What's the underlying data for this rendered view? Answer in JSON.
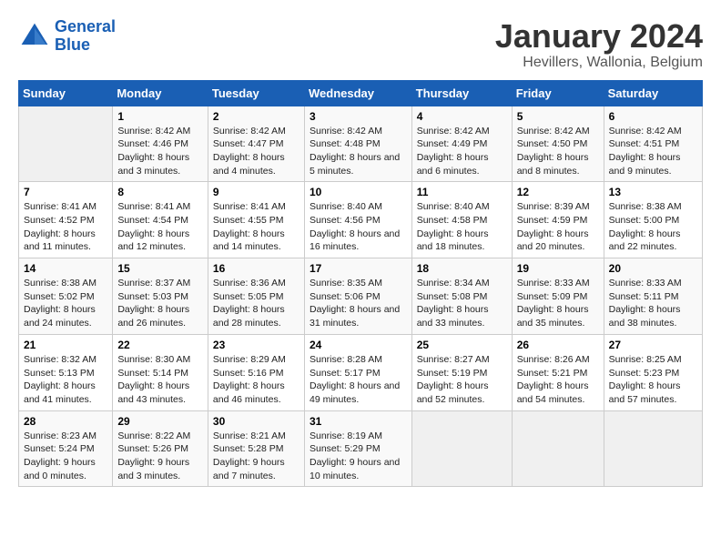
{
  "header": {
    "logo_line1": "General",
    "logo_line2": "Blue",
    "month_title": "January 2024",
    "subtitle": "Hevillers, Wallonia, Belgium"
  },
  "weekdays": [
    "Sunday",
    "Monday",
    "Tuesday",
    "Wednesday",
    "Thursday",
    "Friday",
    "Saturday"
  ],
  "weeks": [
    [
      {
        "day": "",
        "sunrise": "",
        "sunset": "",
        "daylight": ""
      },
      {
        "day": "1",
        "sunrise": "Sunrise: 8:42 AM",
        "sunset": "Sunset: 4:46 PM",
        "daylight": "Daylight: 8 hours and 3 minutes."
      },
      {
        "day": "2",
        "sunrise": "Sunrise: 8:42 AM",
        "sunset": "Sunset: 4:47 PM",
        "daylight": "Daylight: 8 hours and 4 minutes."
      },
      {
        "day": "3",
        "sunrise": "Sunrise: 8:42 AM",
        "sunset": "Sunset: 4:48 PM",
        "daylight": "Daylight: 8 hours and 5 minutes."
      },
      {
        "day": "4",
        "sunrise": "Sunrise: 8:42 AM",
        "sunset": "Sunset: 4:49 PM",
        "daylight": "Daylight: 8 hours and 6 minutes."
      },
      {
        "day": "5",
        "sunrise": "Sunrise: 8:42 AM",
        "sunset": "Sunset: 4:50 PM",
        "daylight": "Daylight: 8 hours and 8 minutes."
      },
      {
        "day": "6",
        "sunrise": "Sunrise: 8:42 AM",
        "sunset": "Sunset: 4:51 PM",
        "daylight": "Daylight: 8 hours and 9 minutes."
      }
    ],
    [
      {
        "day": "7",
        "sunrise": "Sunrise: 8:41 AM",
        "sunset": "Sunset: 4:52 PM",
        "daylight": "Daylight: 8 hours and 11 minutes."
      },
      {
        "day": "8",
        "sunrise": "Sunrise: 8:41 AM",
        "sunset": "Sunset: 4:54 PM",
        "daylight": "Daylight: 8 hours and 12 minutes."
      },
      {
        "day": "9",
        "sunrise": "Sunrise: 8:41 AM",
        "sunset": "Sunset: 4:55 PM",
        "daylight": "Daylight: 8 hours and 14 minutes."
      },
      {
        "day": "10",
        "sunrise": "Sunrise: 8:40 AM",
        "sunset": "Sunset: 4:56 PM",
        "daylight": "Daylight: 8 hours and 16 minutes."
      },
      {
        "day": "11",
        "sunrise": "Sunrise: 8:40 AM",
        "sunset": "Sunset: 4:58 PM",
        "daylight": "Daylight: 8 hours and 18 minutes."
      },
      {
        "day": "12",
        "sunrise": "Sunrise: 8:39 AM",
        "sunset": "Sunset: 4:59 PM",
        "daylight": "Daylight: 8 hours and 20 minutes."
      },
      {
        "day": "13",
        "sunrise": "Sunrise: 8:38 AM",
        "sunset": "Sunset: 5:00 PM",
        "daylight": "Daylight: 8 hours and 22 minutes."
      }
    ],
    [
      {
        "day": "14",
        "sunrise": "Sunrise: 8:38 AM",
        "sunset": "Sunset: 5:02 PM",
        "daylight": "Daylight: 8 hours and 24 minutes."
      },
      {
        "day": "15",
        "sunrise": "Sunrise: 8:37 AM",
        "sunset": "Sunset: 5:03 PM",
        "daylight": "Daylight: 8 hours and 26 minutes."
      },
      {
        "day": "16",
        "sunrise": "Sunrise: 8:36 AM",
        "sunset": "Sunset: 5:05 PM",
        "daylight": "Daylight: 8 hours and 28 minutes."
      },
      {
        "day": "17",
        "sunrise": "Sunrise: 8:35 AM",
        "sunset": "Sunset: 5:06 PM",
        "daylight": "Daylight: 8 hours and 31 minutes."
      },
      {
        "day": "18",
        "sunrise": "Sunrise: 8:34 AM",
        "sunset": "Sunset: 5:08 PM",
        "daylight": "Daylight: 8 hours and 33 minutes."
      },
      {
        "day": "19",
        "sunrise": "Sunrise: 8:33 AM",
        "sunset": "Sunset: 5:09 PM",
        "daylight": "Daylight: 8 hours and 35 minutes."
      },
      {
        "day": "20",
        "sunrise": "Sunrise: 8:33 AM",
        "sunset": "Sunset: 5:11 PM",
        "daylight": "Daylight: 8 hours and 38 minutes."
      }
    ],
    [
      {
        "day": "21",
        "sunrise": "Sunrise: 8:32 AM",
        "sunset": "Sunset: 5:13 PM",
        "daylight": "Daylight: 8 hours and 41 minutes."
      },
      {
        "day": "22",
        "sunrise": "Sunrise: 8:30 AM",
        "sunset": "Sunset: 5:14 PM",
        "daylight": "Daylight: 8 hours and 43 minutes."
      },
      {
        "day": "23",
        "sunrise": "Sunrise: 8:29 AM",
        "sunset": "Sunset: 5:16 PM",
        "daylight": "Daylight: 8 hours and 46 minutes."
      },
      {
        "day": "24",
        "sunrise": "Sunrise: 8:28 AM",
        "sunset": "Sunset: 5:17 PM",
        "daylight": "Daylight: 8 hours and 49 minutes."
      },
      {
        "day": "25",
        "sunrise": "Sunrise: 8:27 AM",
        "sunset": "Sunset: 5:19 PM",
        "daylight": "Daylight: 8 hours and 52 minutes."
      },
      {
        "day": "26",
        "sunrise": "Sunrise: 8:26 AM",
        "sunset": "Sunset: 5:21 PM",
        "daylight": "Daylight: 8 hours and 54 minutes."
      },
      {
        "day": "27",
        "sunrise": "Sunrise: 8:25 AM",
        "sunset": "Sunset: 5:23 PM",
        "daylight": "Daylight: 8 hours and 57 minutes."
      }
    ],
    [
      {
        "day": "28",
        "sunrise": "Sunrise: 8:23 AM",
        "sunset": "Sunset: 5:24 PM",
        "daylight": "Daylight: 9 hours and 0 minutes."
      },
      {
        "day": "29",
        "sunrise": "Sunrise: 8:22 AM",
        "sunset": "Sunset: 5:26 PM",
        "daylight": "Daylight: 9 hours and 3 minutes."
      },
      {
        "day": "30",
        "sunrise": "Sunrise: 8:21 AM",
        "sunset": "Sunset: 5:28 PM",
        "daylight": "Daylight: 9 hours and 7 minutes."
      },
      {
        "day": "31",
        "sunrise": "Sunrise: 8:19 AM",
        "sunset": "Sunset: 5:29 PM",
        "daylight": "Daylight: 9 hours and 10 minutes."
      },
      {
        "day": "",
        "sunrise": "",
        "sunset": "",
        "daylight": ""
      },
      {
        "day": "",
        "sunrise": "",
        "sunset": "",
        "daylight": ""
      },
      {
        "day": "",
        "sunrise": "",
        "sunset": "",
        "daylight": ""
      }
    ]
  ]
}
